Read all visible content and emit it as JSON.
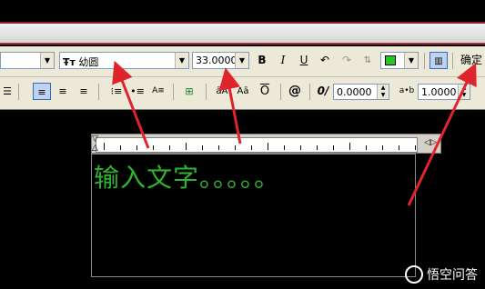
{
  "toolbar": {
    "style_value": "",
    "font_prefix": "Ŧᴛ",
    "font_value": "幼圆",
    "height_value": "33.0000",
    "bold_label": "B",
    "italic_label": "I",
    "underline_label": "U",
    "ok_label": "确定",
    "text_color": "#22c822",
    "oblique_value": "0.0000",
    "width_factor_value": "1.0000",
    "width_factor_prefix": "a•b",
    "oblique_prefix": "0/",
    "at_symbol": "@"
  },
  "editor": {
    "typed_text": "输入文字。。。。。",
    "text_color": "#2fb42f"
  },
  "watermark": {
    "label": "悟空问答"
  },
  "colors": {
    "arrow": "#e0242c",
    "title_accent": "#b3283a",
    "toolbar_bg": "#ece9d8"
  }
}
